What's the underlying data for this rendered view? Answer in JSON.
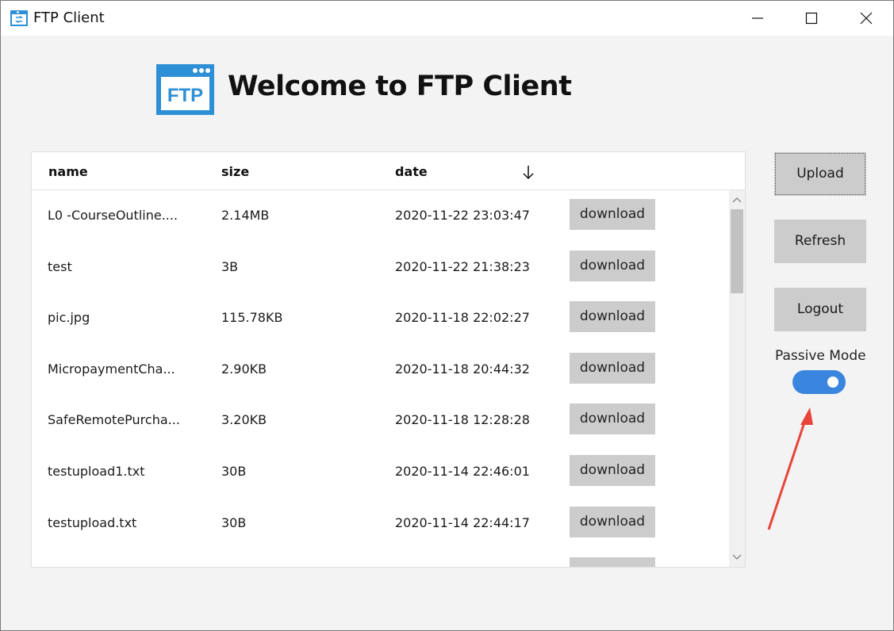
{
  "window": {
    "title": "FTP Client"
  },
  "header": {
    "welcome": "Welcome to FTP Client",
    "logo_text": "FTP"
  },
  "table": {
    "columns": [
      "name",
      "size",
      "date"
    ],
    "sort_icon": "arrow-down-icon",
    "action_label": "download",
    "rows": [
      {
        "name": "L0 -CourseOutline....",
        "size": "2.14MB",
        "date": "2020-11-22 23:03:47"
      },
      {
        "name": "test",
        "size": "3B",
        "date": "2020-11-22 21:38:23"
      },
      {
        "name": "pic.jpg",
        "size": "115.78KB",
        "date": "2020-11-18 22:02:27"
      },
      {
        "name": "MicropaymentCha...",
        "size": "2.90KB",
        "date": "2020-11-18 20:44:32"
      },
      {
        "name": "SafeRemotePurcha...",
        "size": "3.20KB",
        "date": "2020-11-18 12:28:28"
      },
      {
        "name": "testupload1.txt",
        "size": "30B",
        "date": "2020-11-14 22:46:01"
      },
      {
        "name": "testupload.txt",
        "size": "30B",
        "date": "2020-11-14 22:44:17"
      }
    ]
  },
  "sidebar": {
    "upload": "Upload",
    "refresh": "Refresh",
    "logout": "Logout",
    "passive_label": "Passive Mode",
    "passive_on": true
  },
  "colors": {
    "accent": "#3a86de",
    "button_bg": "#cccccc",
    "logo_blue": "#2d8fd6",
    "annotation": "#e8443a"
  }
}
